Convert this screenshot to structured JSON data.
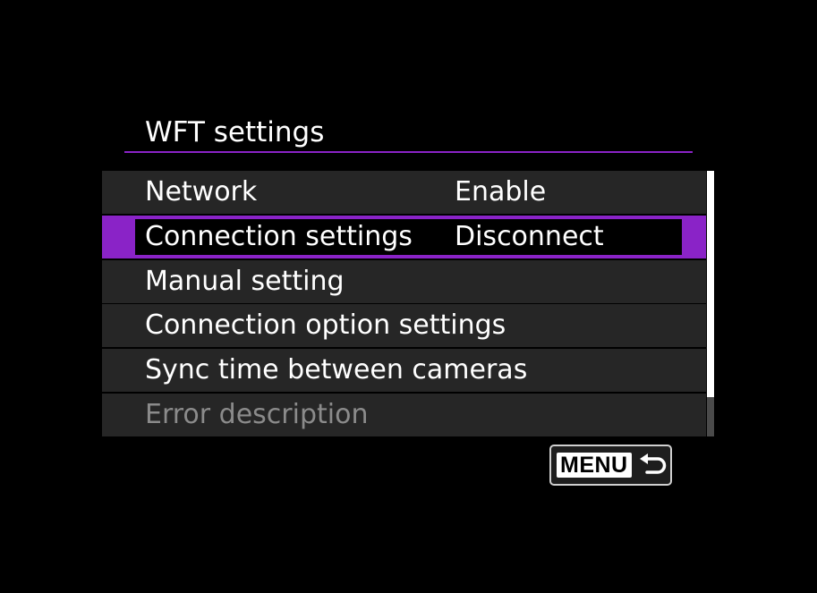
{
  "screen": {
    "title": "WFT settings",
    "accent_color": "#8a23c7"
  },
  "menu": {
    "items": [
      {
        "label": "Network",
        "value": "Enable",
        "state": "normal"
      },
      {
        "label": "Connection settings",
        "value": "Disconnect",
        "state": "selected"
      },
      {
        "label": "Manual setting",
        "value": "",
        "state": "normal"
      },
      {
        "label": "Connection option settings",
        "value": "",
        "state": "normal"
      },
      {
        "label": "Sync time between cameras",
        "value": "",
        "state": "normal"
      },
      {
        "label": "Error description",
        "value": "",
        "state": "disabled"
      }
    ]
  },
  "footer": {
    "menu_button_label": "MENU",
    "return_icon": "return-arrow-icon"
  }
}
